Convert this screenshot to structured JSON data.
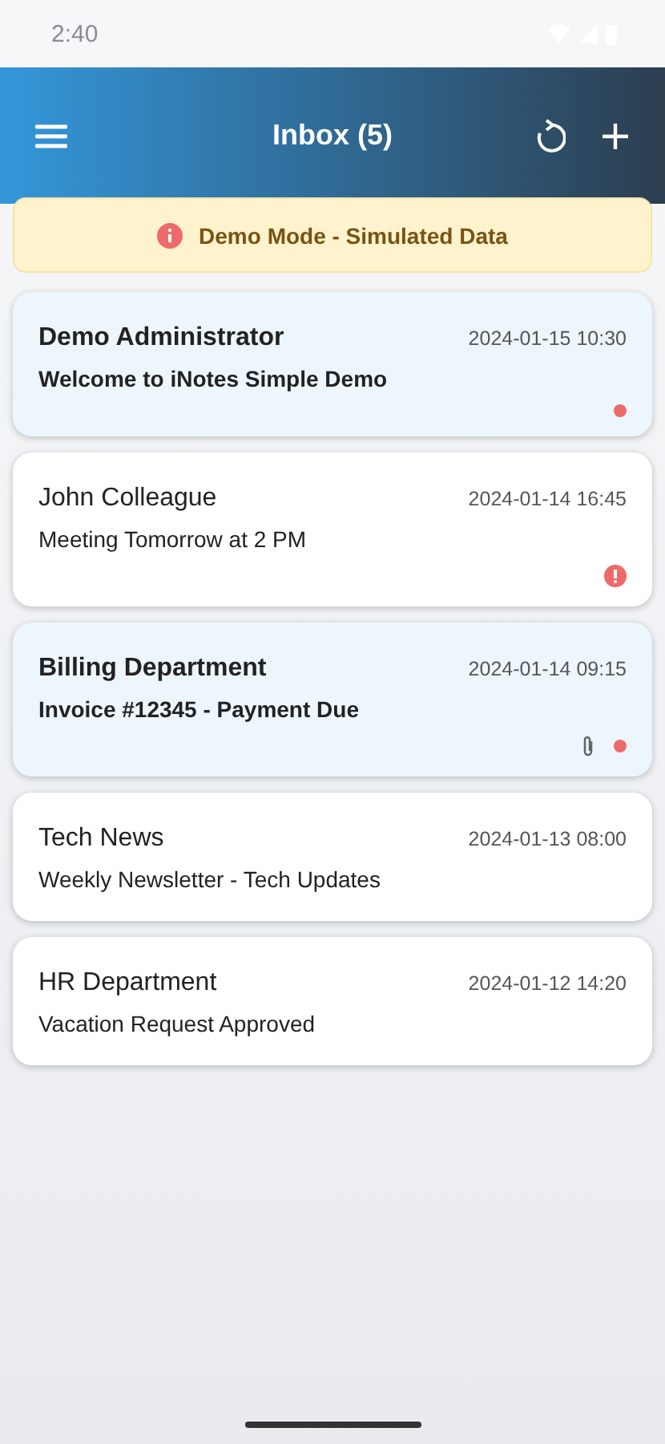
{
  "status_bar": {
    "time": "2:40"
  },
  "header": {
    "title": "Inbox (5)"
  },
  "banner": {
    "text": "Demo Mode - Simulated Data"
  },
  "messages": [
    {
      "sender": "Demo Administrator",
      "subject": "Welcome to iNotes Simple Demo",
      "date": "2024-01-15 10:30",
      "unread": true,
      "important": false,
      "attachment": false
    },
    {
      "sender": "John Colleague",
      "subject": "Meeting Tomorrow at 2 PM",
      "date": "2024-01-14 16:45",
      "unread": false,
      "important": true,
      "attachment": false
    },
    {
      "sender": "Billing Department",
      "subject": "Invoice #12345 - Payment Due",
      "date": "2024-01-14 09:15",
      "unread": true,
      "important": false,
      "attachment": true
    },
    {
      "sender": "Tech News",
      "subject": "Weekly Newsletter - Tech Updates",
      "date": "2024-01-13 08:00",
      "unread": false,
      "important": false,
      "attachment": false
    },
    {
      "sender": "HR Department",
      "subject": "Vacation Request Approved",
      "date": "2024-01-12 14:20",
      "unread": false,
      "important": false,
      "attachment": false
    }
  ]
}
